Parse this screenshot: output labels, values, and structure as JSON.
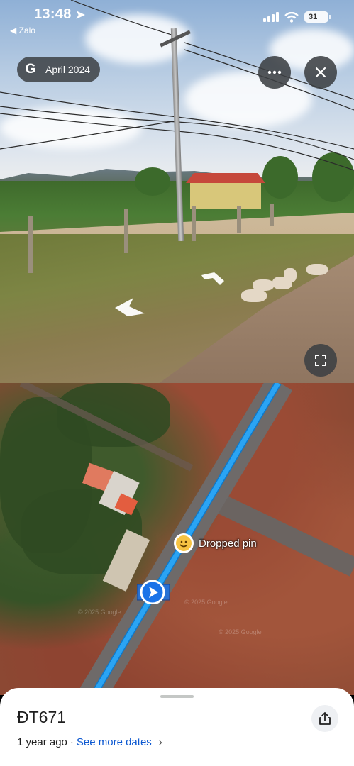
{
  "status_bar": {
    "time": "13:48",
    "back_app": "◀ Zalo",
    "battery": "31"
  },
  "street_view": {
    "date_pill": "April 2024",
    "date_pill_icon": "google-g-icon",
    "more_icon": "more-horizontal-icon",
    "close_icon": "close-icon",
    "expand_icon": "expand-icon"
  },
  "map": {
    "pin_label": "Dropped pin",
    "watermark": "© 2025 Google",
    "road_color": "#2aa4f4"
  },
  "sheet": {
    "title": "ĐT671",
    "age": "1 year ago",
    "separator": "·",
    "see_more": "See more dates",
    "share_icon": "share-icon"
  },
  "colors": {
    "link": "#0b57d0",
    "overlay_button": "#3c4043"
  }
}
